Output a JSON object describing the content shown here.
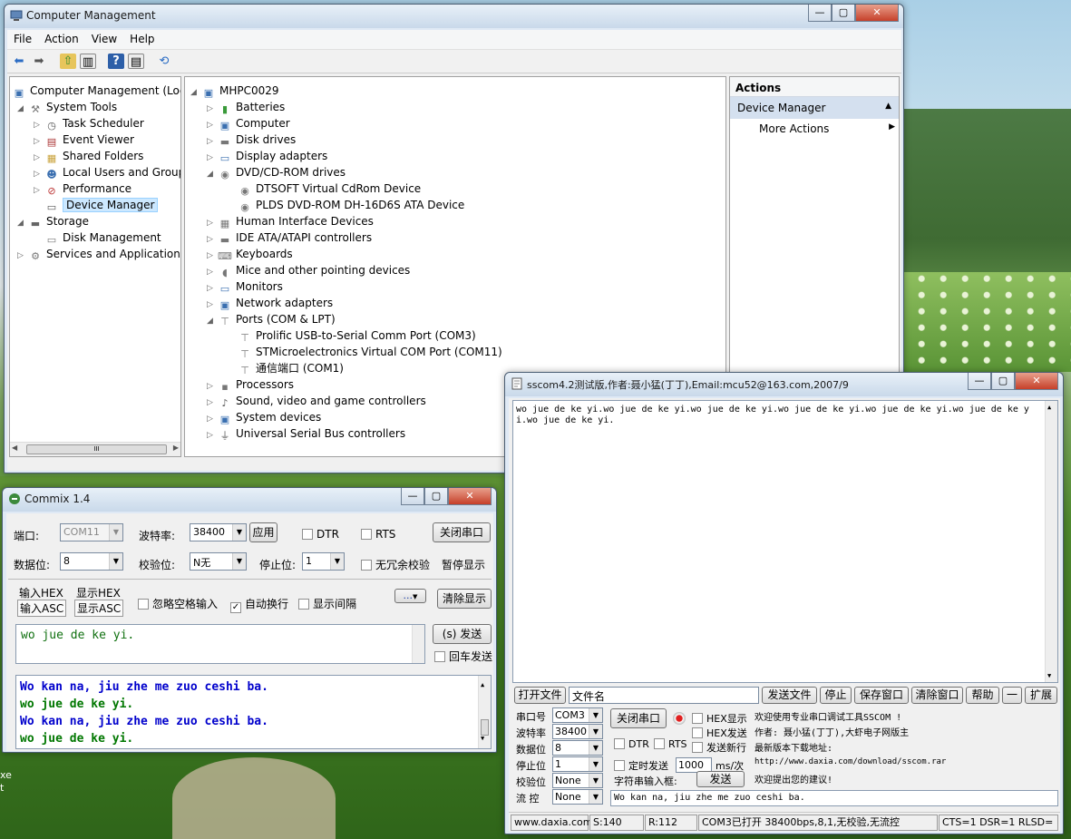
{
  "cm": {
    "title": "Computer Management",
    "menu": [
      "File",
      "Action",
      "View",
      "Help"
    ],
    "left_tree": [
      "Computer Management (Local",
      "System Tools",
      "Task Scheduler",
      "Event Viewer",
      "Shared Folders",
      "Local Users and Groups",
      "Performance",
      "Device Manager",
      "Storage",
      "Disk Management",
      "Services and Applications"
    ],
    "hscroll": "III",
    "device_root": "MHPC0029",
    "devices": [
      "Batteries",
      "Computer",
      "Disk drives",
      "Display adapters",
      "DVD/CD-ROM drives",
      "DTSOFT Virtual CdRom Device",
      "PLDS DVD-ROM DH-16D6S ATA Device",
      "Human Interface Devices",
      "IDE ATA/ATAPI controllers",
      "Keyboards",
      "Mice and other pointing devices",
      "Monitors",
      "Network adapters",
      "Ports (COM & LPT)",
      "Prolific USB-to-Serial Comm Port (COM3)",
      "STMicroelectronics Virtual COM Port (COM11)",
      "通信端口 (COM1)",
      "Processors",
      "Sound, video and game controllers",
      "System devices",
      "Universal Serial Bus controllers"
    ],
    "actions_header": "Actions",
    "actions_selected": "Device Manager",
    "actions_more": "More Actions"
  },
  "commix": {
    "title": "Commix 1.4",
    "port_label": "端口:",
    "port_value": "COM11",
    "baud_label": "波特率:",
    "baud_value": "38400",
    "apply_button": "应用",
    "dtr": "DTR",
    "rts": "RTS",
    "close_port_button": "关闭串口",
    "databits_label": "数据位:",
    "databits_value": "8",
    "parity_label": "校验位:",
    "parity_value": "N无",
    "stopbits_label": "停止位:",
    "stopbits_value": "1",
    "no_redundant_check": "无冗余校验",
    "pause_display": "暂停显示",
    "input_hex": "输入HEX",
    "display_hex": "显示HEX",
    "input_asc": "输入ASC",
    "display_asc": "显示ASC",
    "ignore_space": "忽略空格输入",
    "auto_wrap": "自动换行",
    "show_interval": "显示间隔",
    "more_button": "...",
    "clear_display_button": "清除显示",
    "input_text": "wo jue de ke yi.",
    "send_button": "(s) 发送",
    "cr_send": "回车发送",
    "output_lines": [
      {
        "text": "Wo kan na, jiu zhe me zuo ceshi ba.",
        "color": "#0000cc"
      },
      {
        "text": "wo jue de ke yi.",
        "color": "#007700"
      },
      {
        "text": "Wo kan na, jiu zhe me zuo ceshi ba.",
        "color": "#0000cc"
      },
      {
        "text": "wo jue de ke yi.",
        "color": "#007700"
      }
    ]
  },
  "sscom": {
    "title": "sscom4.2测试版,作者:聂小猛(丁丁),Email:mcu52@163.com,2007/9",
    "receive_text": "wo jue de ke yi.wo jue de ke yi.wo jue de ke yi.wo jue de ke yi.wo jue de ke yi.wo jue de ke yi.wo jue de ke yi.",
    "open_file_button": "打开文件",
    "file_name": "文件名",
    "send_file_button": "发送文件",
    "stop_button": "停止",
    "save_window_button": "保存窗口",
    "clear_window_button": "清除窗口",
    "help_button": "帮助",
    "minus_button": "一",
    "expand_button": "扩展",
    "port_label": "串口号",
    "port_value": "COM3",
    "baud_label": "波特率",
    "baud_value": "38400",
    "databits_label": "数据位",
    "databits_value": "8",
    "stopbits_label": "停止位",
    "stopbits_value": "1",
    "parity_label": "校验位",
    "parity_value": "None",
    "flow_label": "流 控",
    "flow_value": "None",
    "close_port_button": "关闭串口",
    "hex_display": "HEX显示",
    "hex_send": "HEX发送",
    "send_newline": "发送新行",
    "dtr": "DTR",
    "rts": "RTS",
    "timed_send": "定时发送",
    "interval_value": "1000",
    "interval_unit": "ms/次",
    "input_label": "字符串输入框:",
    "send_button": "发送",
    "info_lines": [
      "欢迎使用专业串口调试工具SSCOM !",
      "作者: 聂小猛(丁丁),大虾电子网版主",
      "最新版本下载地址:",
      "http://www.daxia.com/download/sscom.rar",
      "欢迎提出您的建议!"
    ],
    "send_text": "Wo kan na, jiu zhe me zuo ceshi ba.",
    "status": [
      "www.daxia.com",
      "S:140",
      "R:112",
      "COM3已打开  38400bps,8,1,无校验,无流控",
      "CTS=1 DSR=1 RLSD="
    ]
  },
  "background_text": [
    "xe",
    "t"
  ]
}
